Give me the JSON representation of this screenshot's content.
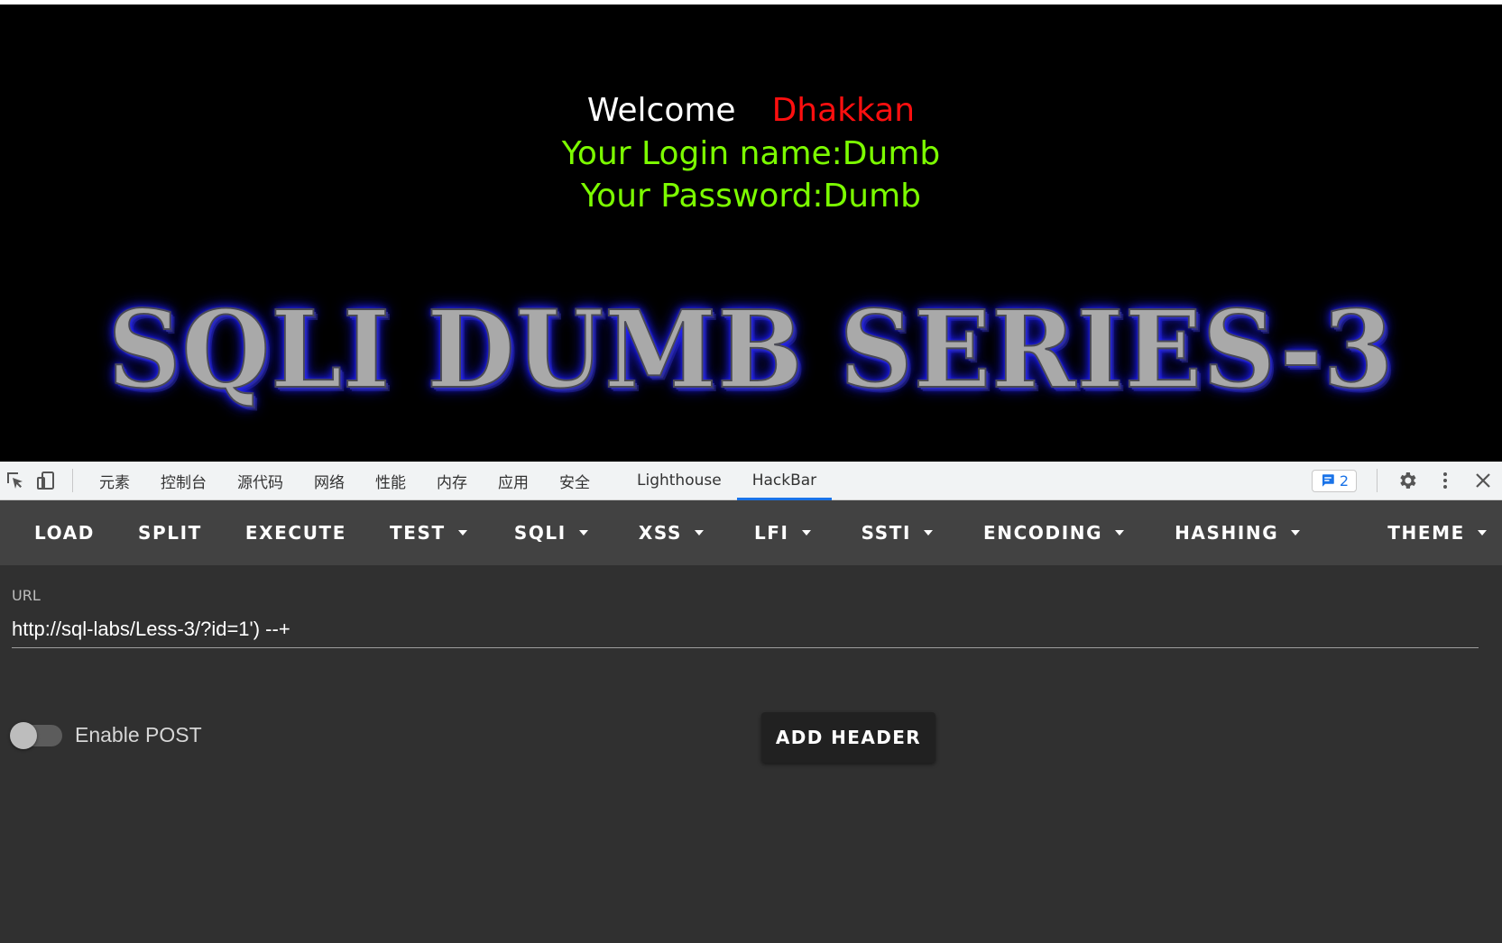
{
  "page": {
    "welcome_word": "Welcome",
    "welcome_user": "Dhakkan",
    "login_line": "Your Login name:Dumb",
    "password_line": "Your Password:Dumb",
    "banner": "SQLI DUMB SERIES-3",
    "colors": {
      "welcome": "#ffffff",
      "user": "#ff0f0f",
      "info": "#7cfc00",
      "banner_glow": "#2020ff"
    }
  },
  "devtools": {
    "tabs": [
      "元素",
      "控制台",
      "源代码",
      "网络",
      "性能",
      "内存",
      "应用",
      "安全",
      "Lighthouse",
      "HackBar"
    ],
    "active_tab": "HackBar",
    "issues_count": "2",
    "icons": [
      "inspect-icon",
      "device-toolbar-icon",
      "issues-icon",
      "gear-icon",
      "more-vert-icon",
      "close-icon"
    ]
  },
  "hackbar": {
    "toolbar": {
      "load": "LOAD",
      "split": "SPLIT",
      "execute": "EXECUTE",
      "test": "TEST",
      "sqli": "SQLI",
      "xss": "XSS",
      "lfi": "LFI",
      "ssti": "SSTI",
      "encoding": "ENCODING",
      "hashing": "HASHING",
      "theme": "THEME"
    },
    "url_label": "URL",
    "url_value": "http://sql-labs/Less-3/?id=1') --+",
    "enable_post_label": "Enable POST",
    "enable_post": false,
    "add_header_label": "ADD HEADER"
  }
}
